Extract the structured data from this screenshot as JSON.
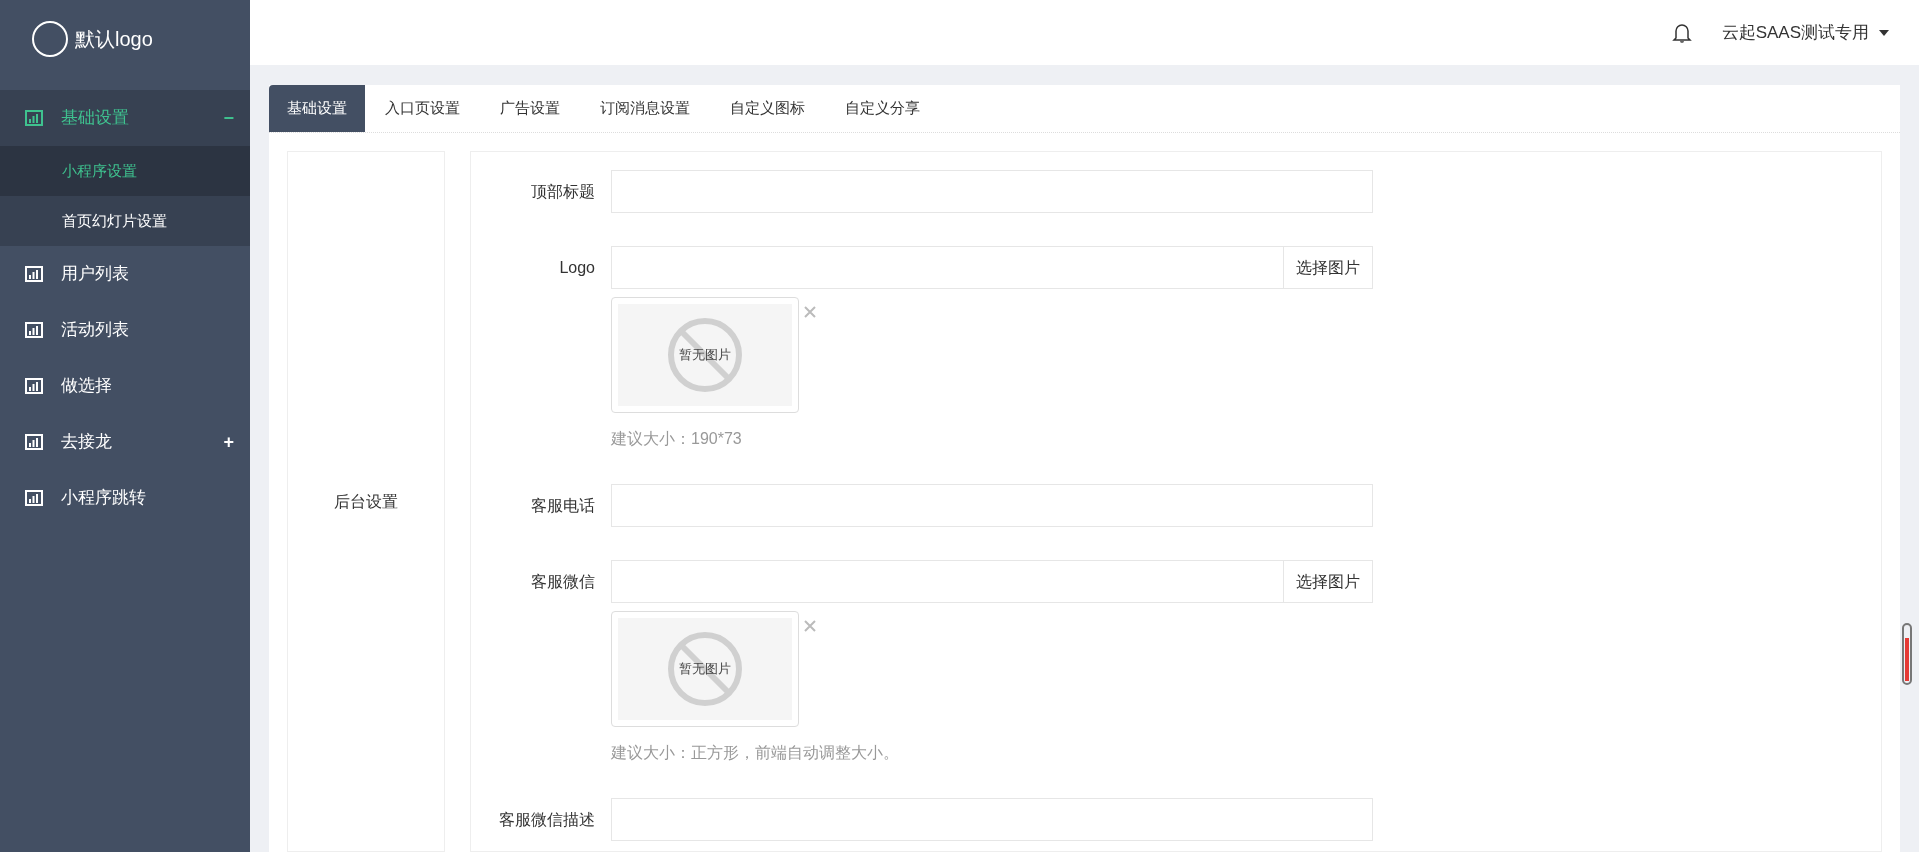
{
  "logo": {
    "text": "默认logo"
  },
  "sidebar": {
    "items": [
      {
        "label": "基础设置",
        "expanded": true,
        "toggle": "−",
        "selected": true,
        "children": [
          {
            "label": "小程序设置",
            "selected": true
          },
          {
            "label": "首页幻灯片设置",
            "selected": false
          }
        ]
      },
      {
        "label": "用户列表",
        "selected": false
      },
      {
        "label": "活动列表",
        "selected": false
      },
      {
        "label": "做选择",
        "selected": false
      },
      {
        "label": "去接龙",
        "expanded": false,
        "toggle": "+",
        "selected": false
      },
      {
        "label": "小程序跳转",
        "selected": false
      }
    ]
  },
  "header": {
    "user": "云起SAAS测试专用"
  },
  "tabs": [
    {
      "label": "基础设置",
      "selected": true
    },
    {
      "label": "入口页设置",
      "selected": false
    },
    {
      "label": "广告设置",
      "selected": false
    },
    {
      "label": "订阅消息设置",
      "selected": false
    },
    {
      "label": "自定义图标",
      "selected": false
    },
    {
      "label": "自定义分享",
      "selected": false
    }
  ],
  "section": {
    "label": "后台设置"
  },
  "form": [
    {
      "kind": "text",
      "label": "顶部标题"
    },
    {
      "kind": "image",
      "label": "Logo",
      "button": "选择图片",
      "preview": "暂无图片",
      "hint": "建议大小：190*73"
    },
    {
      "kind": "text",
      "label": "客服电话"
    },
    {
      "kind": "image",
      "label": "客服微信",
      "button": "选择图片",
      "preview": "暂无图片",
      "hint": "建议大小：正方形，前端自动调整大小。"
    },
    {
      "kind": "text",
      "label": "客服微信描述"
    }
  ]
}
